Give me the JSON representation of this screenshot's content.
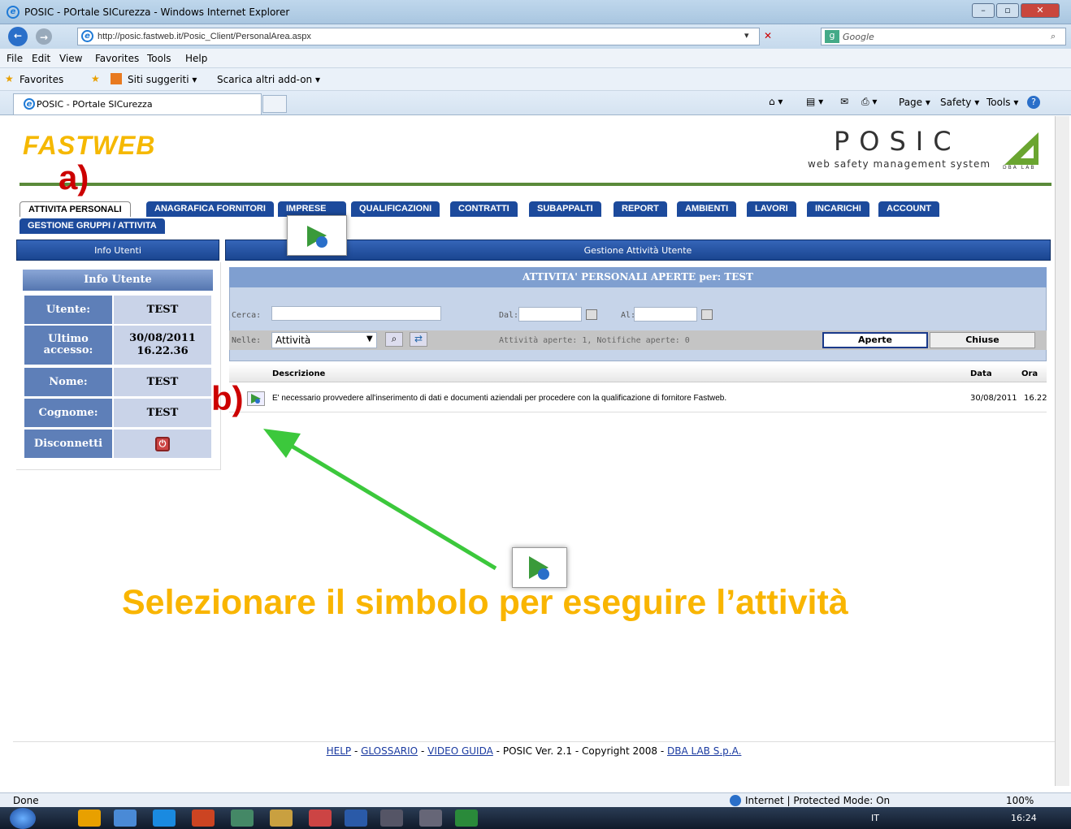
{
  "window": {
    "title": "POSIC - POrtale SICurezza - Windows Internet Explorer"
  },
  "address": {
    "url": "http://posic.fastweb.it/Posic_Client/PersonalArea.aspx",
    "search_placeholder": "Google"
  },
  "menu": [
    "File",
    "Edit",
    "View",
    "Favorites",
    "Tools",
    "Help"
  ],
  "favorites": {
    "label": "Favorites",
    "item1": "Siti suggeriti ▾",
    "item2": "Scarica altri add-on ▾"
  },
  "browser_tab": {
    "label": "POSIC - POrtale SICurezza"
  },
  "commandbar": {
    "page": "Page ▾",
    "safety": "Safety ▾",
    "tools": "Tools ▾"
  },
  "header": {
    "logo": "FASTWEB",
    "brand": "POSIC",
    "subtitle": "web safety management system",
    "dba": "DBA LAB"
  },
  "tabs": [
    "ATTIVITA PERSONALI",
    "ANAGRAFICA FORNITORI",
    "IMPRESE",
    "QUALIFICAZIONI",
    "CONTRATTI",
    "SUBAPPALTI",
    "REPORT",
    "AMBIENTI",
    "LAVORI",
    "INCARICHI",
    "ACCOUNT",
    "GESTIONE GRUPPI / ATTIVITA"
  ],
  "left": {
    "bar": "Info Utenti",
    "title": "Info Utente",
    "rows": [
      {
        "label": "Utente:",
        "value": "TEST"
      },
      {
        "label": "Ultimo accesso:",
        "value": "30/08/2011 16.22.36"
      },
      {
        "label": "Nome:",
        "value": "TEST"
      },
      {
        "label": "Cognome:",
        "value": "TEST"
      },
      {
        "label": "Disconnetti",
        "value": ""
      }
    ]
  },
  "main": {
    "bar": "Gestione Attività Utente",
    "panel_title": "ATTIVITA' PERSONALI APERTE per:  TEST",
    "cerca": "Cerca:",
    "dal": "Dal:",
    "al": "Al:",
    "nelle": "Nelle:",
    "select": "Attività",
    "counts": "Attività aperte: 1, Notifiche aperte: 0",
    "btn_open": "Aperte",
    "btn_closed": "Chiuse",
    "col_desc": "Descrizione",
    "col_date": "Data",
    "col_time": "Ora",
    "row": {
      "desc": "E' necessario provvedere all'inserimento di dati e documenti aziendali per procedere con la qualificazione di fornitore Fastweb.",
      "date": "30/08/2011",
      "time": "16.22"
    }
  },
  "footer": {
    "help": "HELP",
    "glossario": "GLOSSARIO",
    "video": "VIDEO GUIDA",
    "sep": "-",
    "ver": "POSIC Ver. 2.1 - Copyright 2008",
    "dba": "DBA LAB S.p.A."
  },
  "annotation": {
    "a": "a)",
    "b": "b)",
    "text": "Selezionare il simbolo per eseguire l’attività"
  },
  "status": {
    "done": "Done",
    "zone": "Internet | Protected Mode: On",
    "zoom": "100%"
  },
  "taskbar": {
    "lang": "IT",
    "time": "16:24"
  },
  "colors": {
    "tab_blue": "#1c4a9c",
    "annot_yellow": "#f9b500",
    "arrow_green": "#3cc83c",
    "label_red": "#cc0000"
  }
}
